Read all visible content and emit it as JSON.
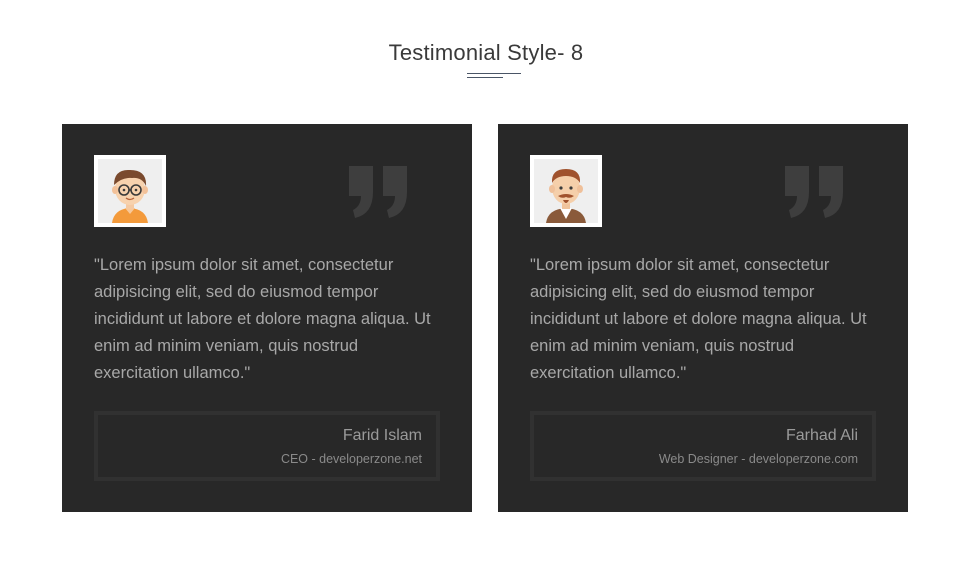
{
  "section": {
    "title": "Testimonial Style- 8"
  },
  "testimonials": [
    {
      "avatar": "avatar-boy-with-glasses",
      "quote_icon": "quote-icon",
      "text": "\"Lorem ipsum dolor sit amet, consectetur adipisicing elit, sed do eiusmod tempor incididunt ut labore et dolore magna aliqua. Ut enim ad minim veniam, quis nostrud exercitation ullamco.\"",
      "name": "Farid Islam",
      "role": "CEO - developerzone.net"
    },
    {
      "avatar": "avatar-man-with-beard",
      "quote_icon": "quote-icon",
      "text": "\"Lorem ipsum dolor sit amet, consectetur adipisicing elit, sed do eiusmod tempor incididunt ut labore et dolore magna aliqua. Ut enim ad minim veniam, quis nostrud exercitation ullamco.\"",
      "name": "Farhad Ali",
      "role": "Web Designer - developerzone.com"
    }
  ],
  "colors": {
    "card_background": "#282828",
    "card_text": "#a8a8a8",
    "quote_icon": "#3e3e3e",
    "title_rule": "#4a5566"
  }
}
